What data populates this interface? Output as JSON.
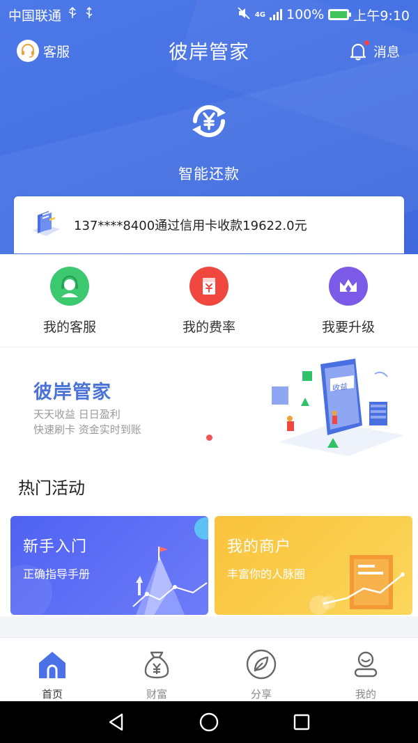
{
  "status_bar": {
    "carrier": "中国联通",
    "network": "4G",
    "battery": "100%",
    "time": "上午9:10"
  },
  "header": {
    "left_label": "客服",
    "title": "彼岸管家",
    "right_label": "消息",
    "has_unread": true
  },
  "hero": {
    "label": "智能还款"
  },
  "notice": {
    "text": "137****8400通过信用卡收款19622.0元"
  },
  "quick_actions": [
    {
      "label": "我的客服",
      "icon": "headset-icon",
      "color": "#3cc86f"
    },
    {
      "label": "我的费率",
      "icon": "rate-icon",
      "color": "#f0473e"
    },
    {
      "label": "我要升级",
      "icon": "crown-icon",
      "color": "#7a5ae6"
    }
  ],
  "banner": {
    "title": "彼岸管家",
    "line1": "天天收益 日日盈利",
    "line2": "快速刷卡 资金实时到账",
    "illustration_text": "收益"
  },
  "hot": {
    "title": "热门活动",
    "cards": [
      {
        "title": "新手入门",
        "subtitle": "正确指导手册"
      },
      {
        "title": "我的商户",
        "subtitle": "丰富你的人脉圈"
      }
    ]
  },
  "tabbar": {
    "items": [
      {
        "label": "首页",
        "icon": "home-icon",
        "active": true
      },
      {
        "label": "财富",
        "icon": "money-bag-icon",
        "active": false
      },
      {
        "label": "分享",
        "icon": "share-leaf-icon",
        "active": false
      },
      {
        "label": "我的",
        "icon": "profile-icon",
        "active": false
      }
    ]
  },
  "colors": {
    "primary": "#4470e2",
    "banner_title": "#4a72d8",
    "card1": "#4f62f2",
    "card2": "#f9c33c"
  }
}
